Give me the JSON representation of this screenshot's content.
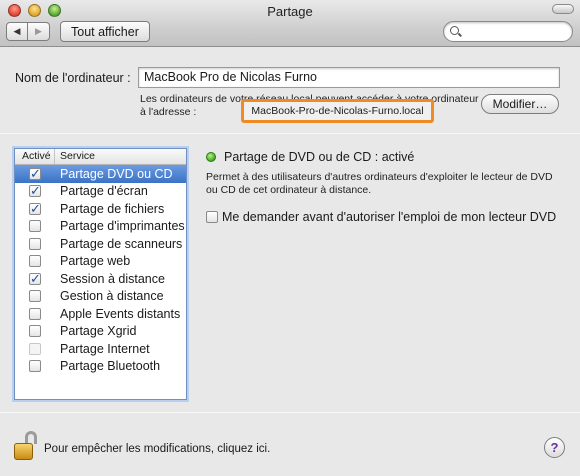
{
  "window": {
    "title": "Partage"
  },
  "toolbar": {
    "back_glyph": "◀",
    "forward_glyph": "▶",
    "show_all_label": "Tout afficher",
    "search_placeholder": ""
  },
  "computer": {
    "name_label": "Nom de l'ordinateur :",
    "name_value": "MacBook Pro de Nicolas Furno",
    "description": "Les ordinateurs de votre réseau local peuvent accéder à votre ordinateur à l'adresse :",
    "address": "MacBook-Pro-de-Nicolas-Furno.local",
    "modify_label": "Modifier…"
  },
  "services": {
    "col_enabled": "Activé",
    "col_service": "Service",
    "items": [
      {
        "label": "Partage DVD ou CD",
        "checked": true,
        "selected": true
      },
      {
        "label": "Partage d'écran",
        "checked": true,
        "selected": false
      },
      {
        "label": "Partage de fichiers",
        "checked": true,
        "selected": false
      },
      {
        "label": "Partage d'imprimantes",
        "checked": false,
        "selected": false
      },
      {
        "label": "Partage de scanneurs",
        "checked": false,
        "selected": false
      },
      {
        "label": "Partage web",
        "checked": false,
        "selected": false
      },
      {
        "label": "Session à distance",
        "checked": true,
        "selected": false
      },
      {
        "label": "Gestion à distance",
        "checked": false,
        "selected": false
      },
      {
        "label": "Apple Events distants",
        "checked": false,
        "selected": false
      },
      {
        "label": "Partage Xgrid",
        "checked": false,
        "selected": false
      },
      {
        "label": "Partage Internet",
        "checked": false,
        "selected": false,
        "disabled": true
      },
      {
        "label": "Partage Bluetooth",
        "checked": false,
        "selected": false
      }
    ]
  },
  "detail": {
    "status_title": "Partage de DVD ou de CD : activé",
    "status_description": "Permet à des utilisateurs d'autres ordinateurs d'exploiter le lecteur de DVD ou CD de cet ordinateur à distance.",
    "ask_label": "Me demander avant d'autoriser l'emploi de mon lecteur DVD",
    "status_color": "#3da21f"
  },
  "footer": {
    "lock_text": "Pour empêcher les modifications, cliquez ici.",
    "help_glyph": "?"
  },
  "colors": {
    "highlight": "#f08a24",
    "selection": "#3a72c6"
  }
}
